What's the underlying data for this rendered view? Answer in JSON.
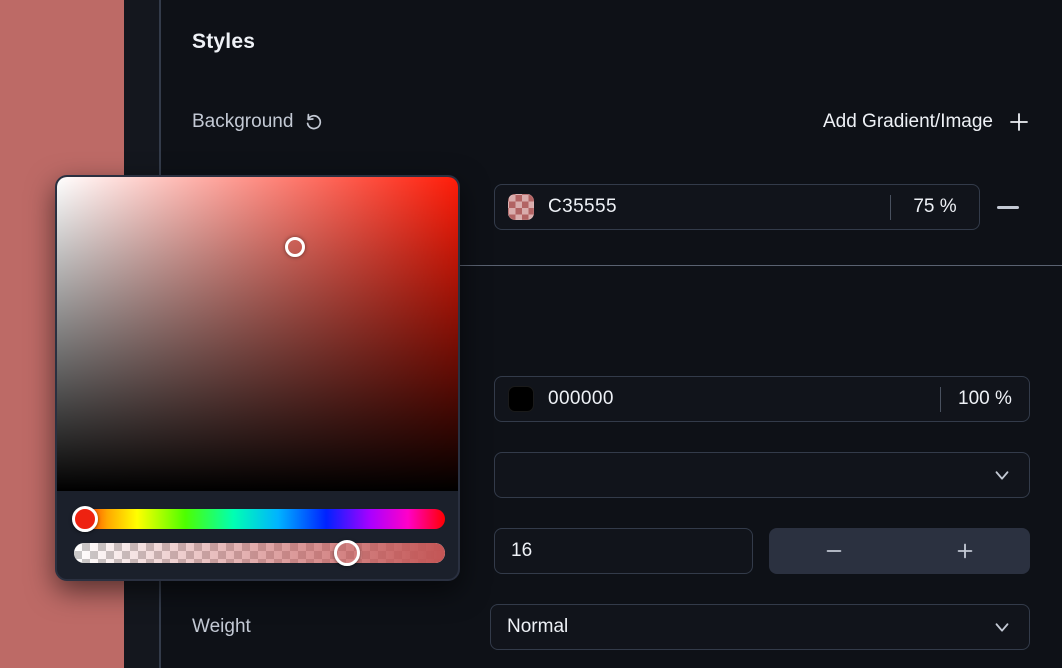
{
  "canvas": {
    "color": "#bd6a66"
  },
  "panel": {
    "title": "Styles",
    "background": {
      "label": "Background",
      "reset_icon": "reset-counterclockwise-icon",
      "add_label": "Add Gradient/Image",
      "add_icon": "plus-icon"
    },
    "layers": [
      {
        "swatch_icon": "checkerboard-swatch-icon",
        "hex": "C35555",
        "opacity": "75",
        "unit": "%",
        "remove_icon": "minus-icon"
      },
      {
        "swatch_icon": "solid-color-swatch-icon",
        "hex": "000000",
        "opacity": "100",
        "unit": "%"
      }
    ],
    "font_family": {
      "value": "",
      "chevron_icon": "chevron-down-icon"
    },
    "font_size": {
      "value": "16",
      "decrement_label": "−",
      "increment_label": "+"
    },
    "weight": {
      "label": "Weight",
      "value": "Normal",
      "chevron_icon": "chevron-down-icon"
    }
  },
  "color_picker": {
    "hue_color": "#ff1a06",
    "hue_handle_fill": "#ee2211",
    "alpha_color": "#C35555",
    "sv_cursor": "saturation-value-cursor",
    "hue_handle": "hue-slider-handle",
    "alpha_handle": "alpha-slider-handle"
  }
}
